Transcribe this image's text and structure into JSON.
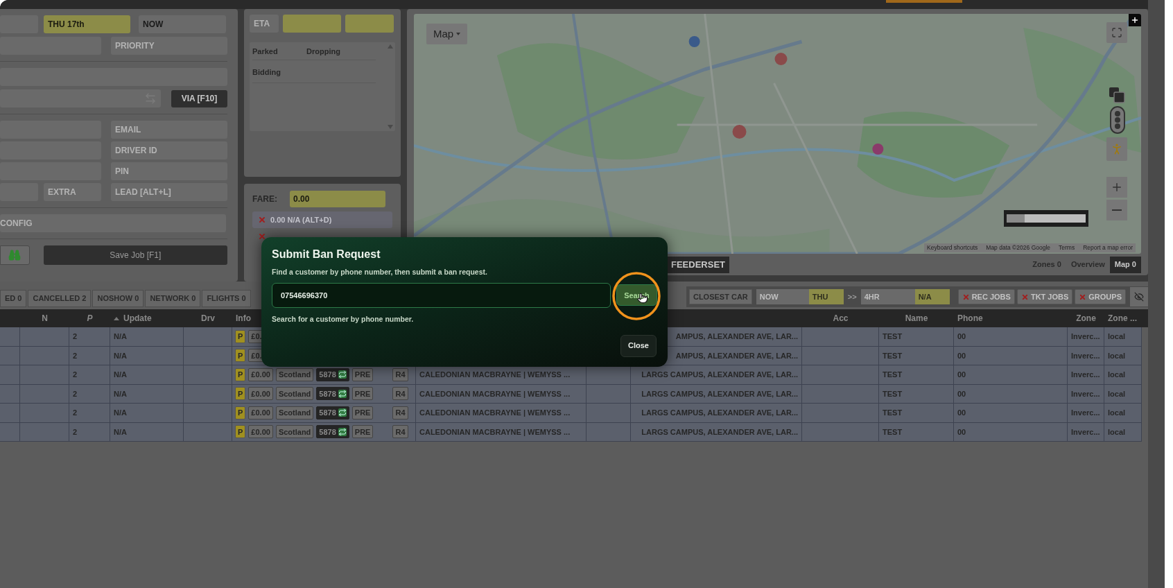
{
  "job_form": {
    "date": {
      "value": "THU 17th",
      "highlighted": true
    },
    "time": {
      "value": "NOW",
      "highlighted": false
    },
    "priority": {
      "placeholder": "PRIORITY"
    },
    "via_button": "VIA [F10]",
    "email": {
      "placeholder": "EMAIL"
    },
    "driver_id": {
      "placeholder": "DRIVER ID"
    },
    "pin": {
      "placeholder": "PIN"
    },
    "extra": {
      "placeholder": "EXTRA"
    },
    "lead": {
      "placeholder": "LEAD [ALT+L]"
    },
    "config": {
      "placeholder": "CONFIG"
    },
    "save_button": "Save Job [F1]"
  },
  "eta_panel": {
    "eta": {
      "placeholder": "ETA"
    },
    "columns": [
      "Parked",
      "Dropping"
    ],
    "rows": [
      "Bidding"
    ]
  },
  "fare_panel": {
    "label": "FARE:",
    "value": "0.00",
    "items": [
      {
        "label": "0.00 N/A (ALT+D)",
        "on": false
      }
    ]
  },
  "map": {
    "type_button": "Map",
    "attribution": [
      "Keyboard shortcuts",
      "Map data ©2026 Google",
      "Terms",
      "Report a map error"
    ],
    "feederset_button": "FEEDERSET",
    "tabs": [
      {
        "label": "Zones 0",
        "selected": false
      },
      {
        "label": "Overview",
        "selected": false
      },
      {
        "label": "Map 0",
        "selected": true
      }
    ]
  },
  "job_tabs": [
    {
      "label": "ED 0",
      "selected": false
    },
    {
      "label": "CANCELLED 2",
      "selected": false
    },
    {
      "label": "NOSHOW 0",
      "selected": false
    },
    {
      "label": "NETWORK 0",
      "selected": false
    },
    {
      "label": "FLIGHTS 0",
      "selected": false
    }
  ],
  "filters": {
    "closest_car": "CLOSEST CAR",
    "from": "NOW",
    "from_day": "THU",
    "separator": ">>",
    "range": "4HR",
    "range_value": "N/A",
    "toggles": [
      {
        "label": "REC JOBS",
        "on": false
      },
      {
        "label": "TKT JOBS",
        "on": false
      },
      {
        "label": "GROUPS",
        "on": false
      }
    ]
  },
  "table": {
    "columns": {
      "n": "N",
      "p": "P",
      "update": "Update",
      "drv": "Drv",
      "info": "Info",
      "acc": "Acc",
      "name": "Name",
      "phone": "Phone",
      "zone": "Zone",
      "zone_2": "Zone ..."
    },
    "sorted_ascending": true,
    "rows": [
      {
        "p": "2",
        "update": "N/A",
        "badge": "P",
        "fare": "£0.",
        "dropoff": "AMPUS, ALEXANDER AVE, LAR...",
        "name": "TEST",
        "phone": "00",
        "zone": "Inverc...",
        "zone_2": "local"
      },
      {
        "p": "2",
        "update": "N/A",
        "badge": "P",
        "fare": "£0.",
        "dropoff": "AMPUS, ALEXANDER AVE, LAR...",
        "name": "TEST",
        "phone": "00",
        "zone": "Inverc...",
        "zone_2": "local"
      },
      {
        "p": "2",
        "update": "N/A",
        "badge": "P",
        "fare": "£0.00",
        "region": "Scotland",
        "car": "5878",
        "booking": "PRE",
        "tag": "R4",
        "pickup": "CALEDONIAN MACBRAYNE | WEMYSS ...",
        "dropoff": "LARGS CAMPUS, ALEXANDER AVE, LAR...",
        "name": "TEST",
        "phone": "00",
        "zone": "Inverc...",
        "zone_2": "local"
      },
      {
        "p": "2",
        "update": "N/A",
        "badge": "P",
        "fare": "£0.00",
        "region": "Scotland",
        "car": "5878",
        "booking": "PRE",
        "tag": "R4",
        "pickup": "CALEDONIAN MACBRAYNE | WEMYSS ...",
        "dropoff": "LARGS CAMPUS, ALEXANDER AVE, LAR...",
        "name": "TEST",
        "phone": "00",
        "zone": "Inverc...",
        "zone_2": "local"
      },
      {
        "p": "2",
        "update": "N/A",
        "badge": "P",
        "fare": "£0.00",
        "region": "Scotland",
        "car": "5878",
        "booking": "PRE",
        "tag": "R4",
        "pickup": "CALEDONIAN MACBRAYNE | WEMYSS ...",
        "dropoff": "LARGS CAMPUS, ALEXANDER AVE, LAR...",
        "name": "TEST",
        "phone": "00",
        "zone": "Inverc...",
        "zone_2": "local"
      },
      {
        "p": "2",
        "update": "N/A",
        "badge": "P",
        "fare": "£0.00",
        "region": "Scotland",
        "car": "5878",
        "booking": "PRE",
        "tag": "R4",
        "pickup": "CALEDONIAN MACBRAYNE | WEMYSS ...",
        "dropoff": "LARGS CAMPUS, ALEXANDER AVE, LAR...",
        "name": "TEST",
        "phone": "00",
        "zone": "Inverc...",
        "zone_2": "local"
      }
    ]
  },
  "modal": {
    "title": "Submit Ban Request",
    "description": "Find a customer by phone number, then submit a ban request.",
    "phone": {
      "value": "07546696370"
    },
    "search_button": "Search",
    "hint": "Search for a customer by phone number.",
    "close_button": "Close"
  }
}
